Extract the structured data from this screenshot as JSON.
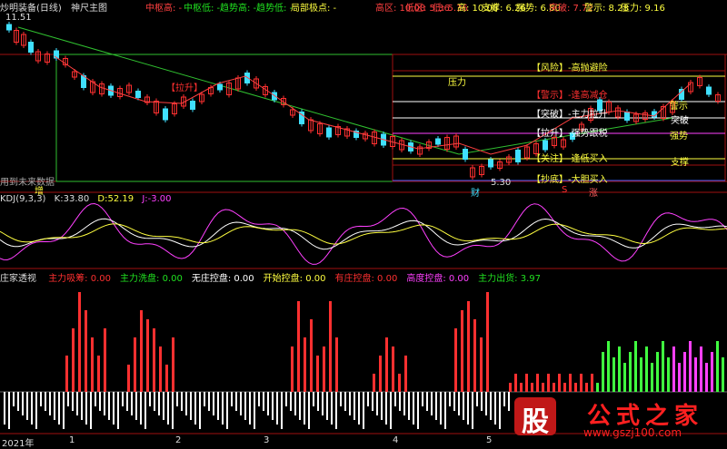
{
  "main_header": {
    "title": "炒明装备(日线)",
    "indicator": "神尺主图",
    "items": [
      {
        "label": "中枢高:",
        "value": "-",
        "color": "#ff4040"
      },
      {
        "label": "中枢低:",
        "value": "-",
        "color": "#20e020"
      },
      {
        "label": "趋势高:",
        "value": "-",
        "color": "#20e020"
      },
      {
        "label": "趋势低:",
        "value": "-",
        "color": "#20e020"
      },
      {
        "label": "局部极点:",
        "value": "-",
        "color": "#ffff40"
      },
      {
        "label": "高区:",
        "value": "10.08",
        "color": "#ff4040"
      },
      {
        "label": "低区:",
        "value": "5.36",
        "color": "#ff4040"
      },
      {
        "label": "低:",
        "value": "5.36",
        "color": "#ff4040"
      },
      {
        "label": "高:",
        "value": "10.08",
        "color": "#ffff40"
      },
      {
        "label": "支撑:",
        "value": "6.26",
        "color": "#ffff40"
      },
      {
        "label": "强势:",
        "value": "6.80",
        "color": "#ffff40"
      },
      {
        "label": "突破:",
        "value": "7.72",
        "color": "#ff4040"
      },
      {
        "label": "警示:",
        "value": "8.28",
        "color": "#ffff40"
      },
      {
        "label": "压力:",
        "value": "9.16",
        "color": "#ffff40"
      }
    ],
    "price_high_label": "11.51",
    "price_low_label": "5.30",
    "future_data_label": "用到未来数据",
    "zeng_label": "增",
    "cai_label": "财",
    "zhang_label": "涨",
    "s_label": "S"
  },
  "zone_labels": [
    {
      "text": "【风险】-高抛避险",
      "color": "#ffff40"
    },
    {
      "text": "【警示】-逢高减仓",
      "color": "#ff3030"
    },
    {
      "text": "【突破】-主力拉升",
      "color": "#ffffff"
    },
    {
      "text": "【拉升】-强势跟税",
      "color": "#ffffff"
    },
    {
      "text": "【关注】-逢低买入",
      "color": "#ffff40"
    },
    {
      "text": "【抄底】-大胆买入",
      "color": "#ffff40"
    }
  ],
  "right_labels": [
    {
      "text": "警示",
      "color": "#ffff40"
    },
    {
      "text": "突破",
      "color": "#ffffff"
    },
    {
      "text": "强势",
      "color": "#ffff40"
    },
    {
      "text": "支撑",
      "color": "#ffff40"
    }
  ],
  "pressure_label": "压力",
  "lasheng_label": "【拉升】",
  "kdj_header": {
    "name": "KDJ(9,3,3)",
    "k_label": "K:",
    "k_value": "33.80",
    "d_label": "D:",
    "d_value": "52.19",
    "j_label": "J:",
    "j_value": "-3.00"
  },
  "vol_header": {
    "name": "庄家透视",
    "items": [
      {
        "label": "主力吸筹:",
        "value": "0.00",
        "color": "#ff3030"
      },
      {
        "label": "主力洗盘:",
        "value": "0.00",
        "color": "#20e020"
      },
      {
        "label": "无庄控盘:",
        "value": "0.00",
        "color": "#ffffff"
      },
      {
        "label": "开始控盘:",
        "value": "0.00",
        "color": "#ffff40"
      },
      {
        "label": "有庄控盘:",
        "value": "0.00",
        "color": "#ff3030"
      },
      {
        "label": "高度控盘:",
        "value": "0.00",
        "color": "#ff40ff"
      },
      {
        "label": "主力出货:",
        "value": "3.97",
        "color": "#20e020"
      }
    ]
  },
  "x_axis_labels": [
    "2021年",
    "1",
    "2",
    "3",
    "4",
    "5"
  ],
  "watermark": {
    "char": "股",
    "text": "公式之家",
    "url": "www.gszj100.com"
  },
  "colors": {
    "up": "#ff3030",
    "down": "#40e0ff",
    "grid": "#b01010",
    "green_line": "#30c030"
  },
  "chart_data": {
    "type": "candlestick",
    "title": "炒明装备(日线)",
    "series_price_min": 5.3,
    "series_price_max": 11.51,
    "levels": {
      "高区": 10.08,
      "低区": 5.36,
      "支撑": 6.26,
      "强势": 6.8,
      "突破": 7.72,
      "警示": 8.28,
      "压力": 9.16
    },
    "kdj": {
      "K": 33.8,
      "D": 52.19,
      "J": -3.0
    },
    "histogram": {
      "主力吸筹": 0,
      "主力洗盘": 0,
      "无庄控盘": 0,
      "开始控盘": 0,
      "有庄控盘": 0,
      "高度控盘": 0,
      "主力出货": 3.97
    }
  }
}
